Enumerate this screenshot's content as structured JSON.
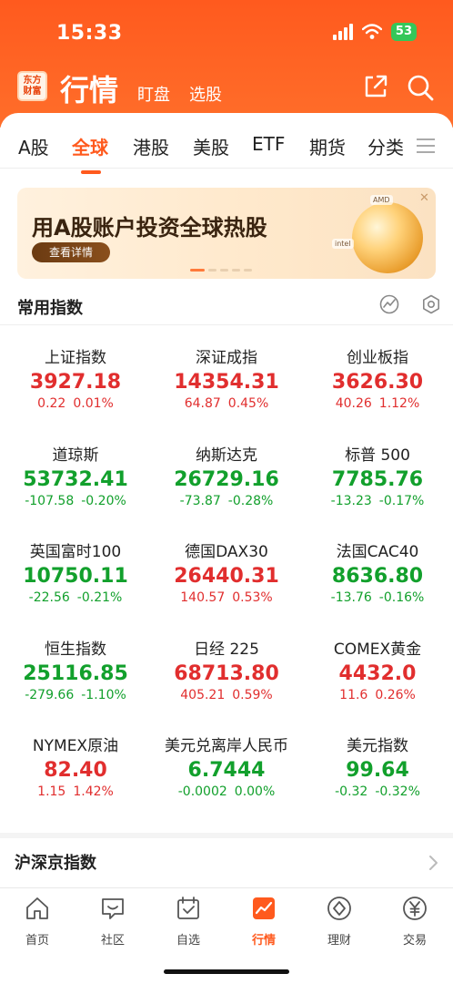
{
  "status_bar": {
    "time": "15:33",
    "battery": "53"
  },
  "app": {
    "logo_line1": "东方",
    "logo_line2": "财富",
    "title": "行情",
    "sub_links": [
      "盯盘",
      "选股"
    ]
  },
  "tabs": [
    {
      "label": "A股",
      "active": false
    },
    {
      "label": "全球",
      "active": true
    },
    {
      "label": "港股",
      "active": false
    },
    {
      "label": "美股",
      "active": false
    },
    {
      "label": "ETF",
      "active": false
    },
    {
      "label": "期货",
      "active": false
    },
    {
      "label": "分类",
      "active": false
    }
  ],
  "banner": {
    "title": "用A股账户投资全球热股",
    "button": "查看详情",
    "close": "✕",
    "logos": [
      "AMD",
      "intel"
    ]
  },
  "section": {
    "title": "常用指数",
    "icons": [
      "chart-compare-icon",
      "settings-icon"
    ]
  },
  "indices": [
    {
      "name": "上证指数",
      "price": "3927.18",
      "change": "0.22",
      "pct": "0.01%",
      "dir": "up"
    },
    {
      "name": "深证成指",
      "price": "14354.31",
      "change": "64.87",
      "pct": "0.45%",
      "dir": "up"
    },
    {
      "name": "创业板指",
      "price": "3626.30",
      "change": "40.26",
      "pct": "1.12%",
      "dir": "up"
    },
    {
      "name": "道琼斯",
      "price": "53732.41",
      "change": "-107.58",
      "pct": "-0.20%",
      "dir": "down"
    },
    {
      "name": "纳斯达克",
      "price": "26729.16",
      "change": "-73.87",
      "pct": "-0.28%",
      "dir": "down"
    },
    {
      "name": "标普 500",
      "price": "7785.76",
      "change": "-13.23",
      "pct": "-0.17%",
      "dir": "down"
    },
    {
      "name": "英国富时100",
      "price": "10750.11",
      "change": "-22.56",
      "pct": "-0.21%",
      "dir": "down"
    },
    {
      "name": "德国DAX30",
      "price": "26440.31",
      "change": "140.57",
      "pct": "0.53%",
      "dir": "up"
    },
    {
      "name": "法国CAC40",
      "price": "8636.80",
      "change": "-13.76",
      "pct": "-0.16%",
      "dir": "down"
    },
    {
      "name": "恒生指数",
      "price": "25116.85",
      "change": "-279.66",
      "pct": "-1.10%",
      "dir": "down"
    },
    {
      "name": "日经 225",
      "price": "68713.80",
      "change": "405.21",
      "pct": "0.59%",
      "dir": "up"
    },
    {
      "name": "COMEX黄金",
      "price": "4432.0",
      "change": "11.6",
      "pct": "0.26%",
      "dir": "up"
    },
    {
      "name": "NYMEX原油",
      "price": "82.40",
      "change": "1.15",
      "pct": "1.42%",
      "dir": "up"
    },
    {
      "name": "美元兑离岸人民币",
      "price": "6.7444",
      "change": "-0.0002",
      "pct": "0.00%",
      "dir": "down"
    },
    {
      "name": "美元指数",
      "price": "99.64",
      "change": "-0.32",
      "pct": "-0.32%",
      "dir": "down"
    }
  ],
  "subsection": {
    "title": "沪深京指数"
  },
  "bottom_nav": [
    {
      "label": "首页",
      "icon": "home-icon",
      "active": false
    },
    {
      "label": "社区",
      "icon": "community-icon",
      "active": false
    },
    {
      "label": "自选",
      "icon": "watchlist-icon",
      "active": false
    },
    {
      "label": "行情",
      "icon": "market-icon",
      "active": true
    },
    {
      "label": "理财",
      "icon": "wealth-icon",
      "active": false
    },
    {
      "label": "交易",
      "icon": "trade-icon",
      "active": false
    }
  ],
  "colors": {
    "accent": "#ff5a1e",
    "up": "#e12e2e",
    "down": "#12a02c"
  }
}
